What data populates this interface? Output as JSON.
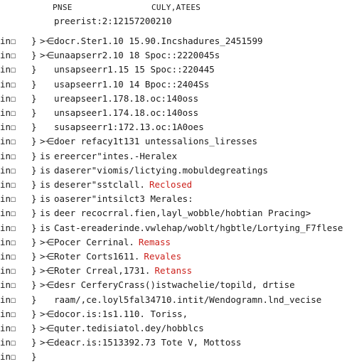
{
  "header": {
    "col1": "PNSE",
    "col2": "CULY,ATEES"
  },
  "top_line": "preerist:2:12157200210",
  "rows": [
    {
      "lead": "in☐",
      "brace": "}",
      "prefix": ">⋲",
      "text": "docr.Ster1.10 15.90.Incshadures_2451599",
      "status": ""
    },
    {
      "lead": "in☐",
      "brace": "}",
      "prefix": ">⋲",
      "text": "unaapserr2.10 18 Spoc::2220045s",
      "status": ""
    },
    {
      "lead": "in☐",
      "brace": "}",
      "prefix": "",
      "text": "unsapseerr1.15 15 Spoc::220445",
      "status": ""
    },
    {
      "lead": "in☐",
      "brace": "}",
      "prefix": "",
      "text": "usapseerr1.10 14 Bpoc::2404Ss",
      "status": ""
    },
    {
      "lead": "in☐",
      "brace": "}",
      "prefix": "",
      "text": "ureapseer1.178.18.oc:140oss",
      "status": ""
    },
    {
      "lead": "in☐",
      "brace": "}",
      "prefix": "",
      "text": "unsapseer1.174.18.oc:140oss",
      "status": ""
    },
    {
      "lead": "in☐",
      "brace": "}",
      "prefix": "",
      "text": "susapseerr1:172.13.oc:1A0oes",
      "status": ""
    },
    {
      "lead": "in☐",
      "brace": "}",
      "prefix": ">⋲",
      "text": "doer refacy1t131 untessalions_liresses",
      "status": ""
    },
    {
      "lead": "in☐",
      "brace": "}",
      "prefix": "is",
      "text": "ereercer\"intes.-Heralex",
      "status": ""
    },
    {
      "lead": "in☐",
      "brace": "}",
      "prefix": "is",
      "text": "daserer\"viomis/lictying.mobuldegreatings",
      "status": ""
    },
    {
      "lead": "in☐",
      "brace": "}",
      "prefix": "is",
      "text": "deserer\"sstclall.",
      "status": "Reclosed"
    },
    {
      "lead": "in☐",
      "brace": "}",
      "prefix": "is",
      "text": "oaserer\"intsilct3 Merales:",
      "status": ""
    },
    {
      "lead": "in☐",
      "brace": "}",
      "prefix": "is",
      "text": "deer recocrral.fien,layl_wobble/hobtian Pracing>",
      "status": ""
    },
    {
      "lead": "in☐",
      "brace": "}",
      "prefix": "is",
      "text": "Cast-ereaderinde.vwlehap/woblt/hgbtle/Lortying_F7flese",
      "status": ""
    },
    {
      "lead": "in☐",
      "brace": "}",
      "prefix": ">⋲",
      "text": "Pocer Cerrinal.",
      "status": "Remass"
    },
    {
      "lead": "in☐",
      "brace": "}",
      "prefix": ">⋲",
      "text": "Roter Corts1611.",
      "status": "Revales"
    },
    {
      "lead": "in☐",
      "brace": "}",
      "prefix": ">⋲",
      "text": "Roter Crreal,1731.",
      "status": "Retanss"
    },
    {
      "lead": "in☐",
      "brace": "}",
      "prefix": ">⋲",
      "text": "desr CerferyCrass()istwachelie/topild, drtise",
      "status": ""
    },
    {
      "lead": "in☐",
      "brace": "}",
      "prefix": "",
      "text": "raam/,ce.loyl5fal34710.intit/Wendogramn.lnd_vecise",
      "status": ""
    },
    {
      "lead": "in☐",
      "brace": "}",
      "prefix": ">⋲",
      "text": "docor.is:1s1.110. Toriss,",
      "status": ""
    },
    {
      "lead": "in☐",
      "brace": "}",
      "prefix": ">⋲",
      "text": "quter.tedisiatol.dey/hobblcs",
      "status": ""
    },
    {
      "lead": "in☐",
      "brace": "}",
      "prefix": ">⋲",
      "text": "deacr.is:1513392.73 Tote V, Mottoss",
      "status": ""
    },
    {
      "lead": "in☐",
      "brace": "}",
      "prefix": "",
      "text": "",
      "status": ""
    }
  ],
  "colors": {
    "text": "#1a1a1a",
    "status_red": "#cc1f1a",
    "background": "#ffffff"
  }
}
